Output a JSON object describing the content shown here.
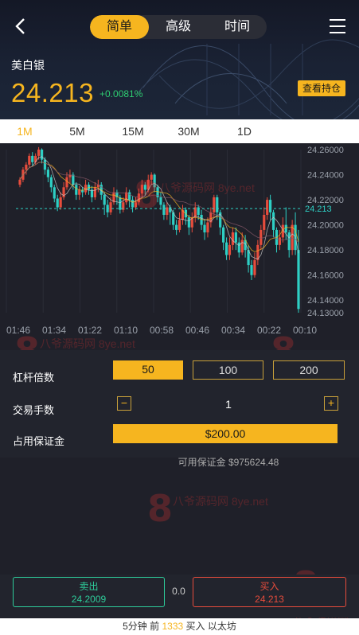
{
  "header": {
    "mode_tabs": [
      {
        "label": "简单",
        "active": true
      },
      {
        "label": "高级",
        "active": false
      },
      {
        "label": "时间",
        "active": false
      }
    ],
    "symbol_name": "美白银",
    "price": "24.213",
    "change": "+0.0081%",
    "positions_label": "查看持仓",
    "back_icon": "chevron-left-icon",
    "menu_icon": "hamburger-menu-icon"
  },
  "periods": [
    {
      "label": "1M",
      "active": true
    },
    {
      "label": "5M",
      "active": false
    },
    {
      "label": "15M",
      "active": false
    },
    {
      "label": "30M",
      "active": false
    },
    {
      "label": "1D",
      "active": false
    }
  ],
  "chart_data": {
    "type": "candlestick",
    "y_ticks": [
      "24.26000",
      "24.24000",
      "24.22000",
      "24.20000",
      "24.18000",
      "24.16000",
      "24.14000",
      "24.13000"
    ],
    "x_ticks": [
      "01:46",
      "01:34",
      "01:22",
      "01:10",
      "00:58",
      "00:46",
      "00:34",
      "00:22",
      "00:10"
    ],
    "ylim": [
      24.13,
      24.26
    ],
    "current_price": "24.213",
    "colors": {
      "up": "#e74c3c",
      "down": "#2ecfc4",
      "current_line": "#2ecfc4",
      "ma": [
        "#c8c8c8",
        "#f6b51f",
        "#8a5a6a"
      ]
    },
    "candles": [
      {
        "o": 24.232,
        "c": 24.236,
        "h": 24.238,
        "l": 24.23
      },
      {
        "o": 24.236,
        "c": 24.244,
        "h": 24.246,
        "l": 24.234
      },
      {
        "o": 24.244,
        "c": 24.248,
        "h": 24.25,
        "l": 24.24
      },
      {
        "o": 24.248,
        "c": 24.255,
        "h": 24.257,
        "l": 24.246
      },
      {
        "o": 24.255,
        "c": 24.25,
        "h": 24.258,
        "l": 24.247
      },
      {
        "o": 24.25,
        "c": 24.255,
        "h": 24.257,
        "l": 24.248
      },
      {
        "o": 24.255,
        "c": 24.26,
        "h": 24.262,
        "l": 24.252
      },
      {
        "o": 24.26,
        "c": 24.252,
        "h": 24.261,
        "l": 24.249
      },
      {
        "o": 24.252,
        "c": 24.244,
        "h": 24.254,
        "l": 24.24
      },
      {
        "o": 24.244,
        "c": 24.238,
        "h": 24.246,
        "l": 24.234
      },
      {
        "o": 24.238,
        "c": 24.23,
        "h": 24.24,
        "l": 24.226
      },
      {
        "o": 24.23,
        "c": 24.221,
        "h": 24.232,
        "l": 24.218
      },
      {
        "o": 24.221,
        "c": 24.214,
        "h": 24.224,
        "l": 24.211
      },
      {
        "o": 24.214,
        "c": 24.222,
        "h": 24.226,
        "l": 24.212
      },
      {
        "o": 24.222,
        "c": 24.23,
        "h": 24.234,
        "l": 24.22
      },
      {
        "o": 24.23,
        "c": 24.238,
        "h": 24.242,
        "l": 24.228
      },
      {
        "o": 24.238,
        "c": 24.24,
        "h": 24.244,
        "l": 24.233
      },
      {
        "o": 24.24,
        "c": 24.232,
        "h": 24.242,
        "l": 24.228
      },
      {
        "o": 24.232,
        "c": 24.224,
        "h": 24.234,
        "l": 24.22
      },
      {
        "o": 24.224,
        "c": 24.228,
        "h": 24.231,
        "l": 24.22
      },
      {
        "o": 24.228,
        "c": 24.226,
        "h": 24.23,
        "l": 24.222
      },
      {
        "o": 24.226,
        "c": 24.232,
        "h": 24.236,
        "l": 24.224
      },
      {
        "o": 24.232,
        "c": 24.228,
        "h": 24.234,
        "l": 24.224
      },
      {
        "o": 24.228,
        "c": 24.222,
        "h": 24.231,
        "l": 24.218
      },
      {
        "o": 24.222,
        "c": 24.23,
        "h": 24.234,
        "l": 24.22
      },
      {
        "o": 24.23,
        "c": 24.232,
        "h": 24.236,
        "l": 24.226
      },
      {
        "o": 24.232,
        "c": 24.224,
        "h": 24.234,
        "l": 24.22
      },
      {
        "o": 24.224,
        "c": 24.216,
        "h": 24.226,
        "l": 24.208
      },
      {
        "o": 24.216,
        "c": 24.21,
        "h": 24.22,
        "l": 24.206
      },
      {
        "o": 24.21,
        "c": 24.218,
        "h": 24.222,
        "l": 24.208
      },
      {
        "o": 24.218,
        "c": 24.226,
        "h": 24.23,
        "l": 24.216
      },
      {
        "o": 24.226,
        "c": 24.222,
        "h": 24.228,
        "l": 24.216
      },
      {
        "o": 24.222,
        "c": 24.212,
        "h": 24.224,
        "l": 24.209
      },
      {
        "o": 24.212,
        "c": 24.218,
        "h": 24.222,
        "l": 24.21
      },
      {
        "o": 24.218,
        "c": 24.226,
        "h": 24.23,
        "l": 24.216
      },
      {
        "o": 24.226,
        "c": 24.22,
        "h": 24.228,
        "l": 24.214
      },
      {
        "o": 24.22,
        "c": 24.214,
        "h": 24.223,
        "l": 24.21
      },
      {
        "o": 24.214,
        "c": 24.218,
        "h": 24.222,
        "l": 24.212
      },
      {
        "o": 24.218,
        "c": 24.225,
        "h": 24.229,
        "l": 24.216
      },
      {
        "o": 24.225,
        "c": 24.232,
        "h": 24.236,
        "l": 24.222
      },
      {
        "o": 24.232,
        "c": 24.228,
        "h": 24.234,
        "l": 24.224
      },
      {
        "o": 24.228,
        "c": 24.236,
        "h": 24.24,
        "l": 24.226
      },
      {
        "o": 24.236,
        "c": 24.24,
        "h": 24.242,
        "l": 24.232
      },
      {
        "o": 24.24,
        "c": 24.23,
        "h": 24.241,
        "l": 24.226
      },
      {
        "o": 24.23,
        "c": 24.222,
        "h": 24.232,
        "l": 24.218
      },
      {
        "o": 24.222,
        "c": 24.216,
        "h": 24.226,
        "l": 24.212
      },
      {
        "o": 24.216,
        "c": 24.208,
        "h": 24.218,
        "l": 24.204
      },
      {
        "o": 24.208,
        "c": 24.214,
        "h": 24.218,
        "l": 24.204
      },
      {
        "o": 24.214,
        "c": 24.21,
        "h": 24.216,
        "l": 24.2
      },
      {
        "o": 24.21,
        "c": 24.2,
        "h": 24.212,
        "l": 24.196
      },
      {
        "o": 24.2,
        "c": 24.196,
        "h": 24.204,
        "l": 24.192
      },
      {
        "o": 24.196,
        "c": 24.204,
        "h": 24.21,
        "l": 24.194
      },
      {
        "o": 24.204,
        "c": 24.212,
        "h": 24.216,
        "l": 24.2
      },
      {
        "o": 24.212,
        "c": 24.206,
        "h": 24.214,
        "l": 24.2
      },
      {
        "o": 24.206,
        "c": 24.198,
        "h": 24.208,
        "l": 24.192
      },
      {
        "o": 24.198,
        "c": 24.206,
        "h": 24.21,
        "l": 24.194
      },
      {
        "o": 24.206,
        "c": 24.214,
        "h": 24.218,
        "l": 24.202
      },
      {
        "o": 24.214,
        "c": 24.208,
        "h": 24.216,
        "l": 24.204
      },
      {
        "o": 24.208,
        "c": 24.2,
        "h": 24.212,
        "l": 24.196
      },
      {
        "o": 24.2,
        "c": 24.194,
        "h": 24.204,
        "l": 24.188
      },
      {
        "o": 24.194,
        "c": 24.202,
        "h": 24.206,
        "l": 24.19
      },
      {
        "o": 24.202,
        "c": 24.21,
        "h": 24.214,
        "l": 24.198
      },
      {
        "o": 24.21,
        "c": 24.222,
        "h": 24.224,
        "l": 24.206
      },
      {
        "o": 24.222,
        "c": 24.21,
        "h": 24.224,
        "l": 24.204
      },
      {
        "o": 24.21,
        "c": 24.198,
        "h": 24.212,
        "l": 24.192
      },
      {
        "o": 24.198,
        "c": 24.186,
        "h": 24.2,
        "l": 24.18
      },
      {
        "o": 24.186,
        "c": 24.176,
        "h": 24.19,
        "l": 24.172
      },
      {
        "o": 24.176,
        "c": 24.184,
        "h": 24.19,
        "l": 24.172
      },
      {
        "o": 24.184,
        "c": 24.194,
        "h": 24.198,
        "l": 24.18
      },
      {
        "o": 24.194,
        "c": 24.186,
        "h": 24.198,
        "l": 24.18
      },
      {
        "o": 24.186,
        "c": 24.178,
        "h": 24.19,
        "l": 24.174
      },
      {
        "o": 24.178,
        "c": 24.188,
        "h": 24.194,
        "l": 24.176
      },
      {
        "o": 24.188,
        "c": 24.18,
        "h": 24.192,
        "l": 24.174
      },
      {
        "o": 24.18,
        "c": 24.168,
        "h": 24.184,
        "l": 24.162
      },
      {
        "o": 24.168,
        "c": 24.16,
        "h": 24.172,
        "l": 24.156
      },
      {
        "o": 24.16,
        "c": 24.172,
        "h": 24.178,
        "l": 24.158
      },
      {
        "o": 24.172,
        "c": 24.184,
        "h": 24.188,
        "l": 24.168
      },
      {
        "o": 24.184,
        "c": 24.196,
        "h": 24.2,
        "l": 24.18
      },
      {
        "o": 24.196,
        "c": 24.208,
        "h": 24.214,
        "l": 24.192
      },
      {
        "o": 24.208,
        "c": 24.22,
        "h": 24.222,
        "l": 24.204
      },
      {
        "o": 24.22,
        "c": 24.21,
        "h": 24.224,
        "l": 24.204
      },
      {
        "o": 24.21,
        "c": 24.196,
        "h": 24.212,
        "l": 24.19
      },
      {
        "o": 24.196,
        "c": 24.184,
        "h": 24.198,
        "l": 24.178
      },
      {
        "o": 24.184,
        "c": 24.19,
        "h": 24.196,
        "l": 24.18
      },
      {
        "o": 24.19,
        "c": 24.2,
        "h": 24.206,
        "l": 24.186
      },
      {
        "o": 24.2,
        "c": 24.194,
        "h": 24.214,
        "l": 24.188
      },
      {
        "o": 24.194,
        "c": 24.18,
        "h": 24.196,
        "l": 24.174
      },
      {
        "o": 24.18,
        "c": 24.2,
        "h": 24.204,
        "l": 24.176
      },
      {
        "o": 24.2,
        "c": 24.18,
        "h": 24.21,
        "l": 24.176
      },
      {
        "o": 24.18,
        "c": 24.133,
        "h": 24.196,
        "l": 24.13
      }
    ]
  },
  "controls": {
    "leverage_label": "杠杆倍数",
    "leverage_options": [
      {
        "label": "50",
        "active": true
      },
      {
        "label": "100",
        "active": false
      },
      {
        "label": "200",
        "active": false
      }
    ],
    "lots_label": "交易手数",
    "minus_label": "−",
    "plus_label": "+",
    "lots_value": "1",
    "margin_label": "占用保证金",
    "margin_value": "$200.00",
    "available_margin": "可用保证金 $975624.48"
  },
  "trade": {
    "sell_label": "卖出",
    "sell_price": "24.2009",
    "spread": "0.0",
    "buy_label": "买入",
    "buy_price": "24.213"
  },
  "footer": {
    "prefix": "5分钟 前",
    "count": "1333",
    "suffix": "买入 以太坊"
  },
  "watermark": {
    "big": "8",
    "small": "八爷源码网 8ye.net"
  }
}
